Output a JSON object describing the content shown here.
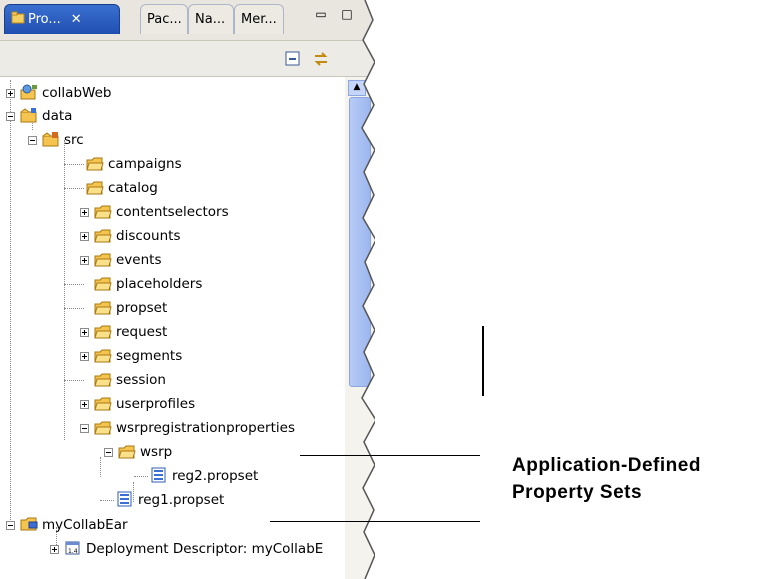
{
  "tabs": [
    {
      "label": "Pro...",
      "active": true
    },
    {
      "label": "Pac...",
      "active": false
    },
    {
      "label": "Na...",
      "active": false
    },
    {
      "label": "Mer...",
      "active": false
    }
  ],
  "tree": [
    {
      "label": "collabWeb",
      "depth": 0,
      "expander": "plus",
      "icon": "web-project-icon"
    },
    {
      "label": "data",
      "depth": 0,
      "expander": "minus",
      "icon": "data-project-icon"
    },
    {
      "label": "src",
      "depth": 1,
      "expander": "minus",
      "icon": "source-folder-icon"
    },
    {
      "label": "campaigns",
      "depth": 2,
      "expander": "none",
      "icon": "folder-icon"
    },
    {
      "label": "catalog",
      "depth": 2,
      "expander": "none",
      "icon": "folder-icon"
    },
    {
      "label": "contentselectors",
      "depth": 2,
      "expander": "plus",
      "icon": "folder-icon"
    },
    {
      "label": "discounts",
      "depth": 2,
      "expander": "plus",
      "icon": "folder-icon"
    },
    {
      "label": "events",
      "depth": 2,
      "expander": "plus",
      "icon": "folder-icon"
    },
    {
      "label": "placeholders",
      "depth": 2,
      "expander": "none",
      "icon": "folder-icon"
    },
    {
      "label": "propset",
      "depth": 2,
      "expander": "none",
      "icon": "folder-icon"
    },
    {
      "label": "request",
      "depth": 2,
      "expander": "plus",
      "icon": "folder-icon"
    },
    {
      "label": "segments",
      "depth": 2,
      "expander": "plus",
      "icon": "folder-icon"
    },
    {
      "label": "session",
      "depth": 2,
      "expander": "none",
      "icon": "folder-icon"
    },
    {
      "label": "userprofiles",
      "depth": 2,
      "expander": "plus",
      "icon": "folder-icon"
    },
    {
      "label": "wsrpregistrationproperties",
      "depth": 2,
      "expander": "minus",
      "icon": "folder-icon"
    },
    {
      "label": "wsrp",
      "depth": 3,
      "expander": "minus",
      "icon": "folder-icon"
    },
    {
      "label": "reg2.propset",
      "depth": 4,
      "expander": "none",
      "icon": "propset-file-icon"
    },
    {
      "label": "reg1.propset",
      "depth": 3,
      "expander": "none",
      "icon": "propset-file-icon"
    },
    {
      "label": "myCollabEar",
      "depth": 0,
      "expander": "minus",
      "icon": "ear-project-icon"
    },
    {
      "label": "Deployment Descriptor: myCollabE",
      "depth": 1,
      "expander": "plus",
      "icon": "descriptor-icon"
    }
  ],
  "callout": {
    "line1": "Application-Defined",
    "line2": "Property Sets"
  },
  "colors": {
    "tab_active": "#2456c2",
    "folder": "#f2c14e",
    "scroll_thumb": "#a9c0f2",
    "propset_icon": "#3b6fd3"
  }
}
